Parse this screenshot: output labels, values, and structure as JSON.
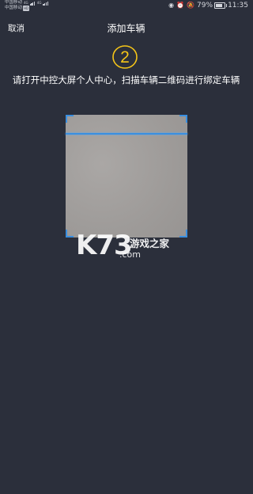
{
  "status_bar": {
    "carrier_1": "中国移动",
    "carrier_2": "中国移动",
    "net_1": "4G",
    "net_2": "4G",
    "hd_label": "HD",
    "battery_percent": "79%",
    "battery_level": 0.79,
    "time": "11:35",
    "icons": [
      "eye-icon",
      "alarm-icon",
      "mute-icon",
      "battery-icon"
    ]
  },
  "header": {
    "cancel_label": "取消",
    "title": "添加车辆"
  },
  "step": {
    "number": "2",
    "color": "#f5c518"
  },
  "instruction": {
    "text": "请打开中控大屏个人中心，扫描车辆二维码进行绑定车辆"
  },
  "scanner": {
    "accent_color": "#3a8fe0"
  },
  "watermark": {
    "logo": "K73",
    "name": "游戏之家",
    "domain": ".com"
  }
}
